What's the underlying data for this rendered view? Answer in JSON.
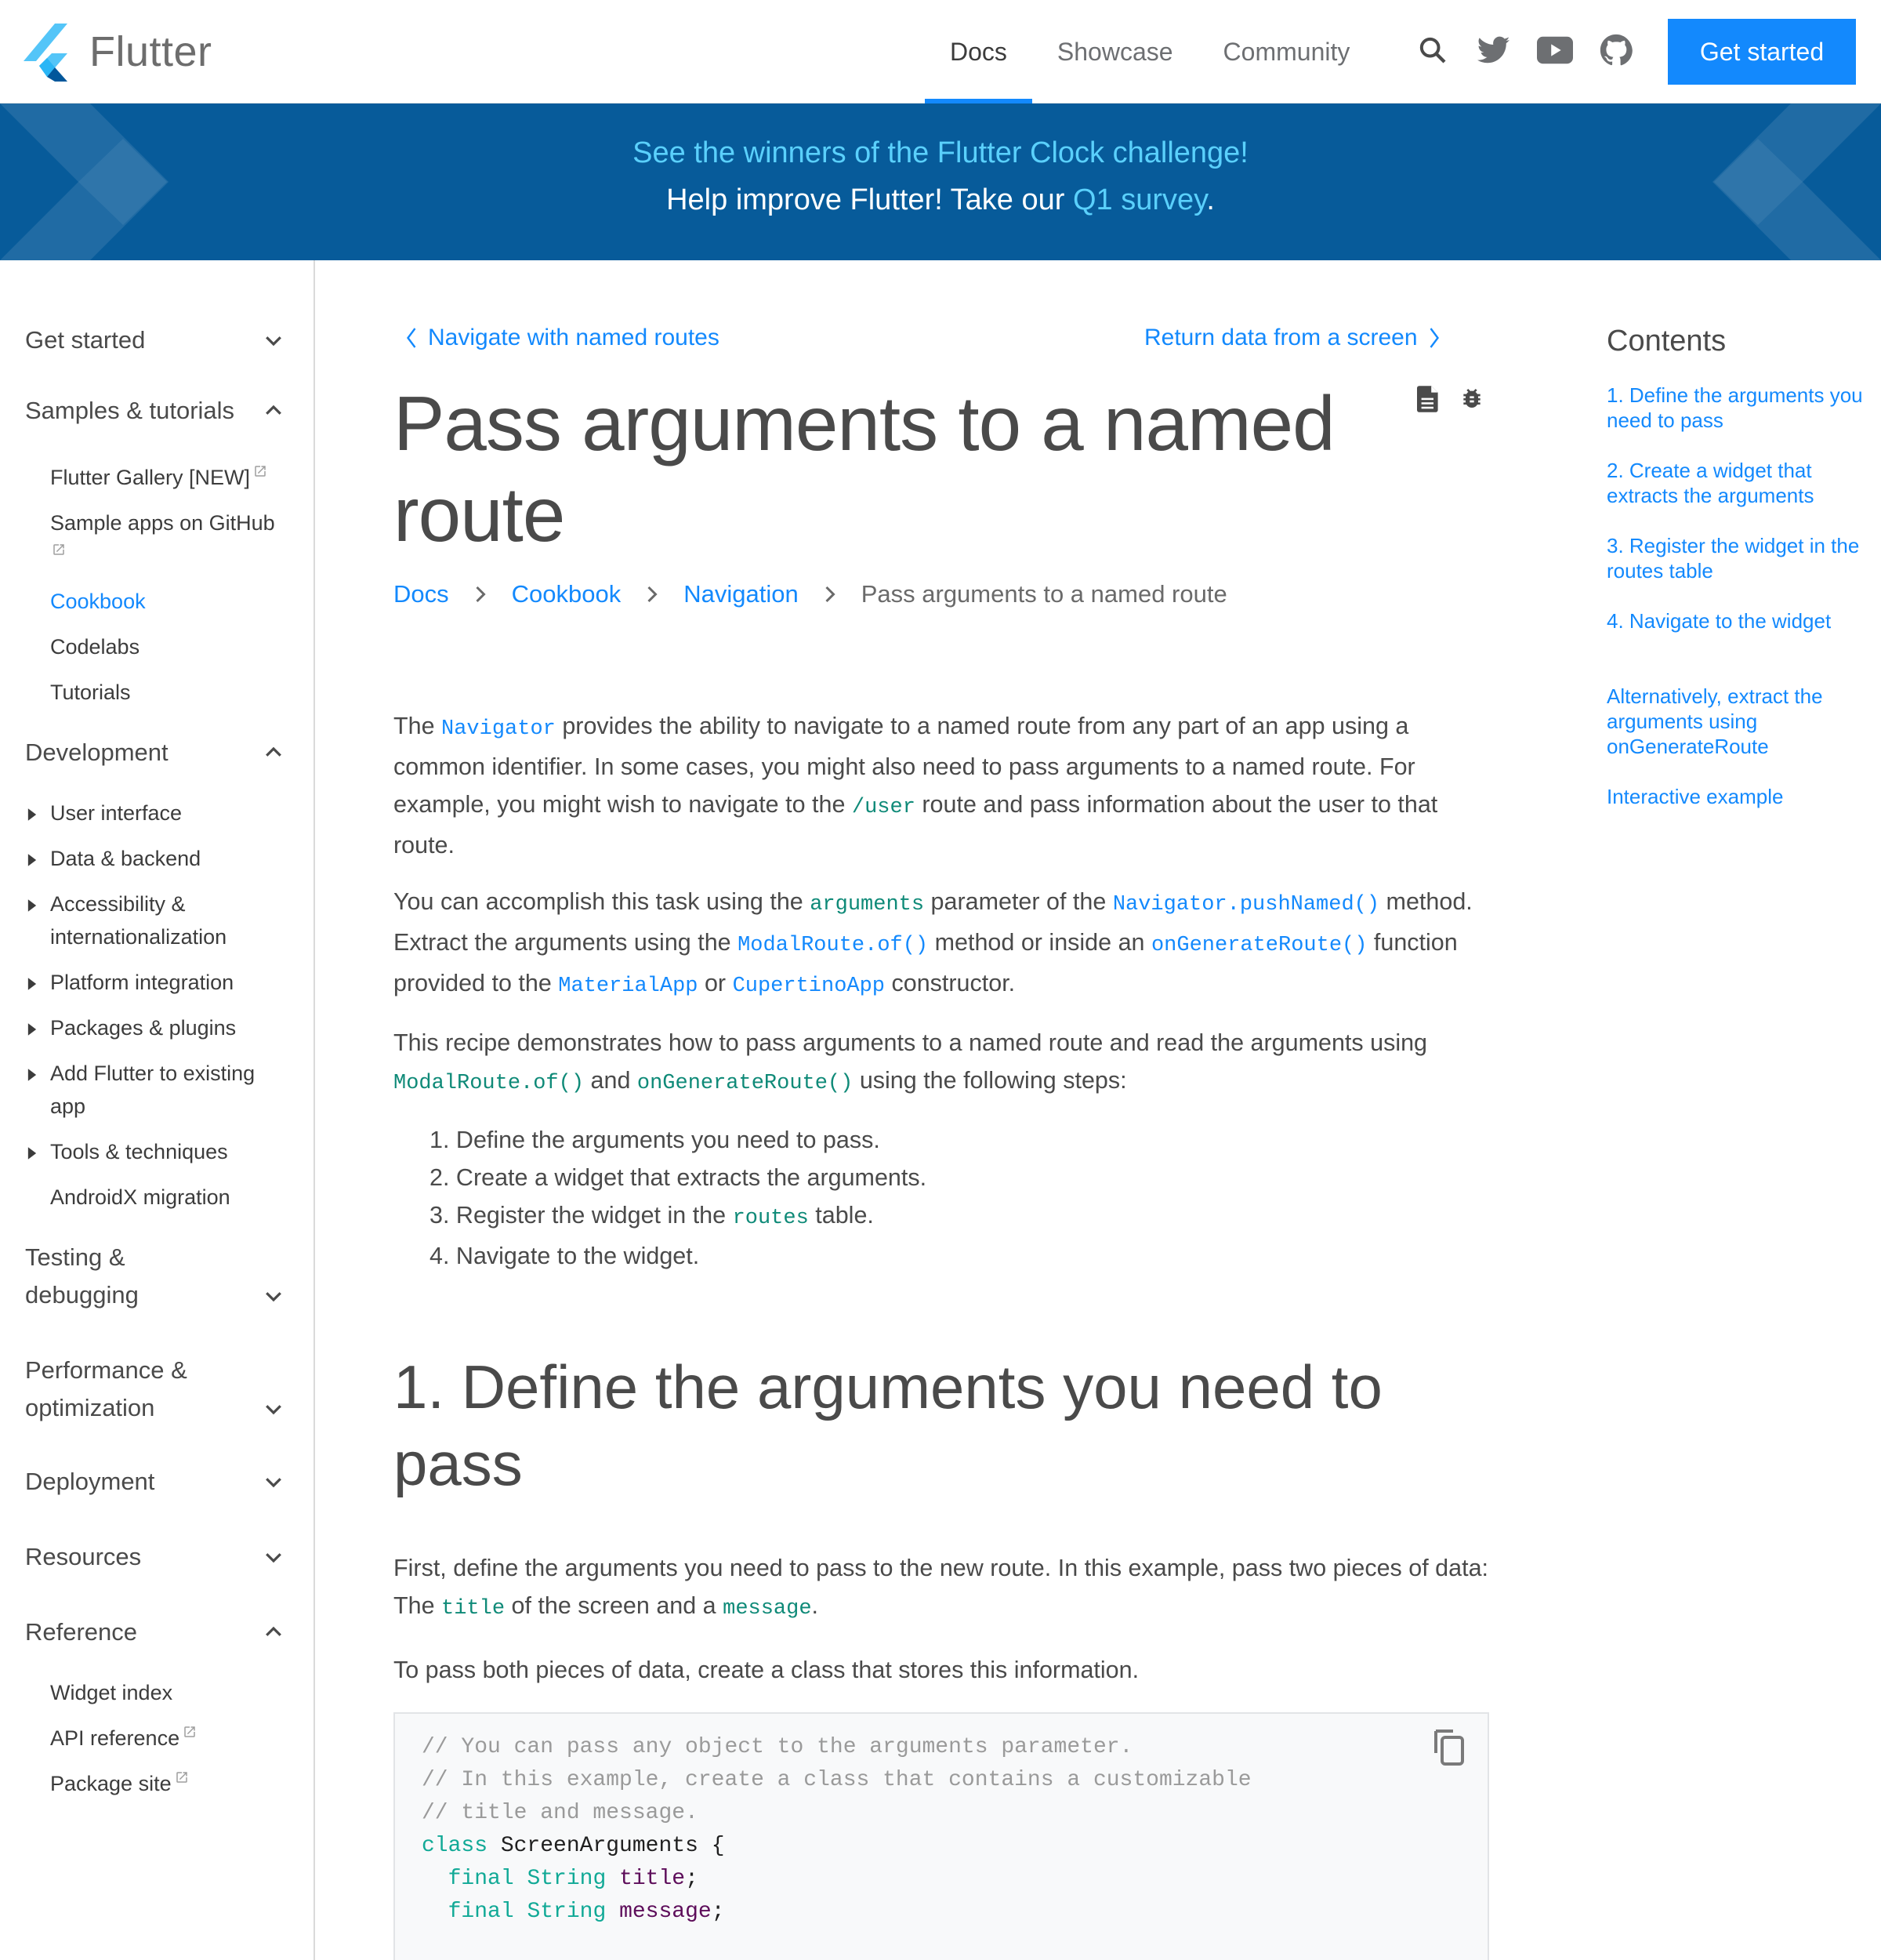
{
  "header": {
    "logo_text": "Flutter",
    "nav": [
      {
        "label": "Docs",
        "active": true
      },
      {
        "label": "Showcase",
        "active": false
      },
      {
        "label": "Community",
        "active": false
      }
    ],
    "icons": [
      "search-icon",
      "twitter-icon",
      "youtube-icon",
      "github-icon"
    ],
    "cta_label": "Get started",
    "accent_color": "#1389fd"
  },
  "banner": {
    "line1": "See the winners of the Flutter Clock challenge!",
    "line2_prefix": "Help improve Flutter! Take our ",
    "line2_link": "Q1 survey",
    "line2_suffix": ".",
    "background_color": "#075b9a"
  },
  "sidebar": {
    "sections": [
      {
        "label": "Get started",
        "expanded": false
      },
      {
        "label": "Samples & tutorials",
        "expanded": true,
        "items": [
          {
            "label": "Flutter Gallery [NEW]",
            "external": true
          },
          {
            "label": "Sample apps on GitHub",
            "external": true
          },
          {
            "label": "Cookbook",
            "active": true
          },
          {
            "label": "Codelabs"
          },
          {
            "label": "Tutorials"
          }
        ]
      },
      {
        "label": "Development",
        "expanded": true,
        "items": [
          {
            "label": "User interface",
            "collapsible": true
          },
          {
            "label": "Data & backend",
            "collapsible": true
          },
          {
            "label": "Accessibility & internationalization",
            "collapsible": true
          },
          {
            "label": "Platform integration",
            "collapsible": true
          },
          {
            "label": "Packages & plugins",
            "collapsible": true
          },
          {
            "label": "Add Flutter to existing app",
            "collapsible": true
          },
          {
            "label": "Tools & techniques",
            "collapsible": true
          },
          {
            "label": "AndroidX migration"
          }
        ]
      },
      {
        "label": "Testing & debugging",
        "expanded": false
      },
      {
        "label": "Performance & optimization",
        "expanded": false
      },
      {
        "label": "Deployment",
        "expanded": false
      },
      {
        "label": "Resources",
        "expanded": false
      },
      {
        "label": "Reference",
        "expanded": true,
        "items": [
          {
            "label": "Widget index"
          },
          {
            "label": "API reference",
            "external": true
          },
          {
            "label": "Package site",
            "external": true
          }
        ]
      }
    ]
  },
  "main": {
    "prev_link": "Navigate with named routes",
    "next_link": "Return data from a screen",
    "title": "Pass arguments to a named route",
    "title_icons": [
      "document-icon",
      "bug-icon"
    ],
    "breadcrumb": [
      "Docs",
      "Cookbook",
      "Navigation"
    ],
    "breadcrumb_current": "Pass arguments to a named route",
    "intro": {
      "p1": [
        "The ",
        "Navigator",
        " provides the ability to navigate to a named route from any part of an app using a common identifier. In some cases, you might also need to pass arguments to a named route. For example, you might wish to navigate to the ",
        "/user",
        " route and pass information about the user to that route."
      ],
      "p2": [
        "You can accomplish this task using the ",
        "arguments",
        " parameter of the ",
        "Navigator.pushNamed()",
        " method. Extract the arguments using the ",
        "ModalRoute.of()",
        " method or inside an ",
        "onGenerateRoute()",
        " function provided to the ",
        "MaterialApp",
        " or ",
        "CupertinoApp",
        " constructor."
      ],
      "p3": [
        "This recipe demonstrates how to pass arguments to a named route and read the arguments using ",
        "ModalRoute.of()",
        " and ",
        "onGenerateRoute()",
        " using the following steps:"
      ]
    },
    "steps": [
      {
        "num": "1.",
        "text": "Define the arguments you need to pass."
      },
      {
        "num": "2.",
        "text": "Create a widget that extracts the arguments."
      },
      {
        "num": "3.",
        "pre": "Register the widget in the ",
        "code": "routes",
        "post": " table."
      },
      {
        "num": "4.",
        "text": "Navigate to the widget."
      }
    ],
    "section1": {
      "heading": "1. Define the arguments you need to pass",
      "p1": [
        "First, define the arguments you need to pass to the new route. In this example, pass two pieces of data: The ",
        "title",
        " of the screen and a ",
        "message",
        "."
      ],
      "p2": "To pass both pieces of data, create a class that stores this information."
    },
    "code": {
      "comments": [
        "// You can pass any object to the arguments parameter.",
        "// In this example, create a class that contains a customizable",
        "// title and message."
      ],
      "class_kw": "class",
      "class_name": "ScreenArguments",
      "open_brace": "{",
      "fields": [
        {
          "mod": "final",
          "type": "String",
          "name": "title"
        },
        {
          "mod": "final",
          "type": "String",
          "name": "message"
        }
      ],
      "copy_icon": "copy-icon"
    }
  },
  "toc": {
    "title": "Contents",
    "items": [
      "1. Define the arguments you need to pass",
      "2. Create a widget that extracts the arguments",
      "3. Register the widget in the routes table",
      "4. Navigate to the widget",
      "Alternatively, extract the arguments using onGenerateRoute",
      "Interactive example"
    ]
  }
}
